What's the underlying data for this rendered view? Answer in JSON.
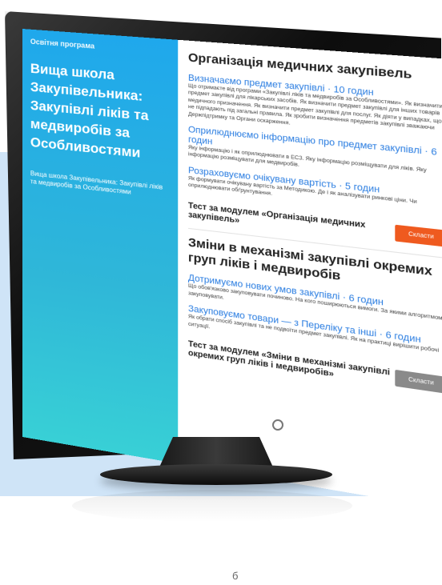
{
  "screen": {
    "left_panel": {
      "program_label": "Освітня програма",
      "course_title": "Вища школа Закупівельника: Закупівлі ліків та медвиробів за Особливостями",
      "course_subtitle": "Вища школа Закупівельника: Закупівлі ліків та медвиробів за Особливостями"
    },
    "modules": [
      {
        "title": "Організація медичних закупівель",
        "lessons": [
          {
            "title": "Визначаємо предмет закупівлі · 10 годин",
            "desc": "Що отримаєте від програми «Закупівлі ліків та медвиробів за Особливостями». Як визначити предмет закупівлі для лікарських засобів. Як визначити предмет закупівлі для інших товарів медичного призначення. Як визначити предмет закупівлі для послуг. Як діяти у випадках, що не підпадають під загальні правила. Як зробити визначення предметів закупівлі зважаючи Держпідтримку та Органи оскарження."
          },
          {
            "title": "Оприлюднюємо інформацію про предмет закупівлі · 6 годин",
            "desc": "Яку інформацію і як оприлюднювати в ЕСЗ. Яку інформацію розміщувати для ліків. Яку інформацію розміщувати для медвиробів."
          },
          {
            "title": "Розраховуємо очікувану вартість · 5 годин",
            "desc": "Як формувати очікувану вартість за Методикою. Де і як аналізувати ринкові ціни. Чи оприлюднювати обґрунтування."
          }
        ],
        "test_label": "Тест за модулем «Організація медичних закупівель»",
        "test_button": "Скласти"
      },
      {
        "title": "Зміни в механізмі закупівлі окремих груп ліків і медвиробів",
        "lessons": [
          {
            "title": "Дотримуємо нових умов закупівлі · 6 годин",
            "desc": "Що обов'язково закуповувати починово. На кого поширюються вимоги. За якими алгоритмом закуповувати."
          },
          {
            "title": "Закуповуємо товари — з Переліку та інші · 6 годин",
            "desc": "Як обрати спосіб закупівлі та не подвоїти предмет закупівлі. Як на практиці вирішити робочі ситуації."
          }
        ],
        "test_label": "Тест за модулем «Зміни в механізмі закупівлі окремих груп ліків і медвиробів»",
        "test_button": "Скласти"
      }
    ]
  },
  "caption": "б"
}
